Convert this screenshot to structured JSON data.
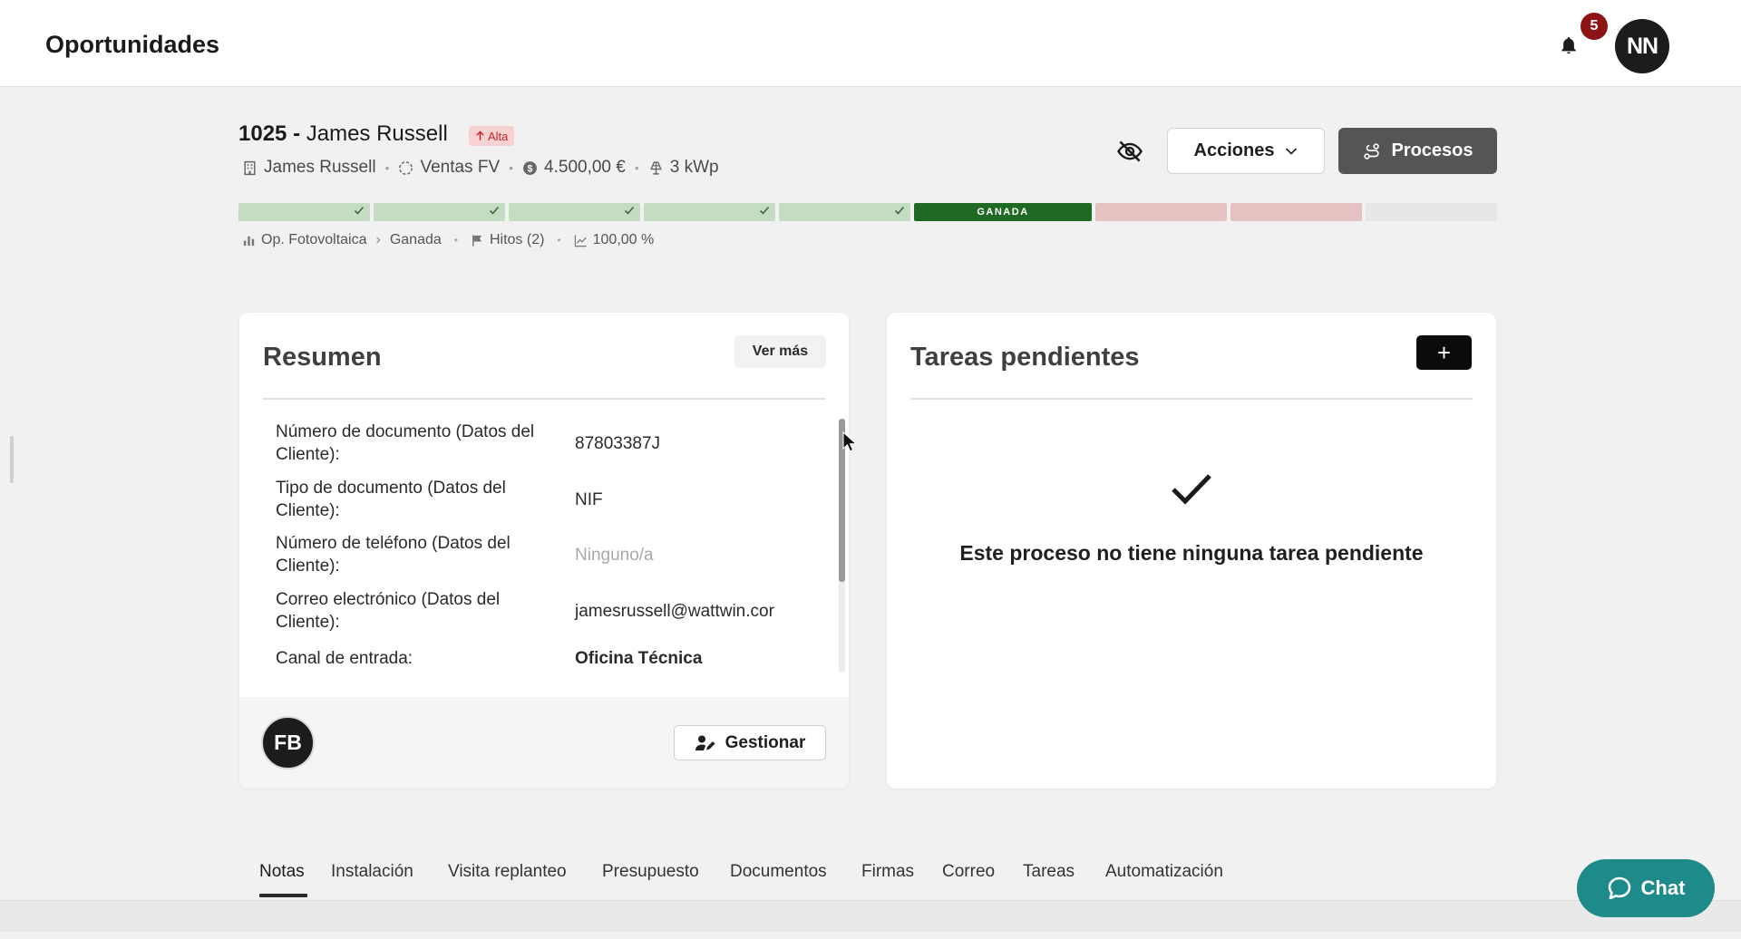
{
  "app": {
    "title": "Oportunidades"
  },
  "notifications": {
    "count": "5"
  },
  "user": {
    "initials": "NN"
  },
  "opportunity": {
    "number": "1025",
    "separator": "-",
    "name": "James Russell",
    "priority": "Alta",
    "company": "James Russell",
    "channel": "Ventas FV",
    "amount": "4.500,00 €",
    "power": "3 kWp"
  },
  "actions": {
    "acciones_label": "Acciones",
    "procesos_label": "Procesos"
  },
  "progress": {
    "completed_stages": 5,
    "current_stage_label": "GANADA",
    "lost_stages": 2,
    "remaining_stages": 1
  },
  "pipeline": {
    "name": "Op. Fotovoltaica",
    "stage": "Ganada",
    "milestones": "Hitos (2)",
    "probability": "100,00 %"
  },
  "summary": {
    "title": "Resumen",
    "ver_mas_label": "Ver más",
    "fields": [
      {
        "label": "Número de documento (Datos del Cliente):",
        "value": "87803387J"
      },
      {
        "label": "Tipo de documento (Datos del Cliente):",
        "value": "NIF"
      },
      {
        "label": "Número de teléfono (Datos del Cliente):",
        "value": "Ninguno/a"
      },
      {
        "label": "Correo electrónico (Datos del Cliente):",
        "value": "jamesrussell@wattwin.cor"
      },
      {
        "label": "Canal de entrada:",
        "value": "Oficina Técnica"
      }
    ],
    "assignee_initials": "FB",
    "gestionar_label": "Gestionar"
  },
  "tasks": {
    "title": "Tareas pendientes",
    "add_label": "+",
    "empty_message": "Este proceso no tiene ninguna tarea pendiente"
  },
  "tabs": [
    {
      "label": "Notas"
    },
    {
      "label": "Instalación"
    },
    {
      "label": "Visita replanteo"
    },
    {
      "label": "Presupuesto"
    },
    {
      "label": "Documentos"
    },
    {
      "label": "Firmas"
    },
    {
      "label": "Correo"
    },
    {
      "label": "Tareas"
    },
    {
      "label": "Automatización"
    }
  ],
  "chat": {
    "label": "Chat"
  },
  "colors": {
    "won": "#1f6a22",
    "done": "#c3dcc2",
    "lost": "#e5c2c2",
    "badge": "#8c1414",
    "chat": "#1f8a8a",
    "procesos": "#555555"
  }
}
